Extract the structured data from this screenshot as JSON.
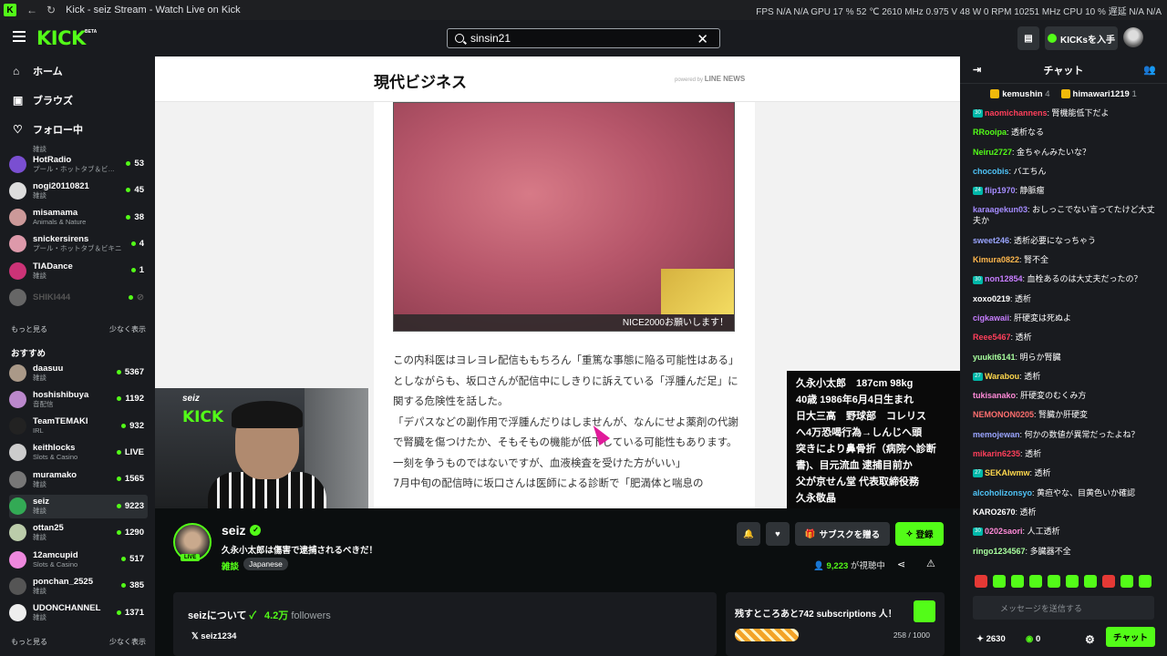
{
  "window": {
    "title": "Kick - seiz Stream - Watch Live on Kick",
    "stats": "FPS N/A N/A   GPU 17 % 52 ℃ 2610 MHz 0.975 V 48 W 0 RPM 10251 MHz   CPU 10 %   遅延 N/A N/A"
  },
  "header": {
    "logo": "KICK",
    "beta": "BETA",
    "search_value": "sinsin21",
    "get_kicks": "KICKsを入手"
  },
  "sidebar": {
    "nav": [
      {
        "label": "ホーム",
        "icon": "home-icon"
      },
      {
        "label": "ブラウズ",
        "icon": "browse-icon"
      },
      {
        "label": "フォロー中",
        "icon": "heart-icon"
      }
    ],
    "partial_category": "雑談",
    "following": [
      {
        "name": "HotRadio",
        "category": "プール・ホットタブ＆ビ…",
        "viewers": "53",
        "color": "#7a4fd1"
      },
      {
        "name": "nogi20110821",
        "category": "雑談",
        "viewers": "45",
        "color": "#ddd"
      },
      {
        "name": "misamama",
        "category": "Animals & Nature",
        "viewers": "38",
        "color": "#c99"
      },
      {
        "name": "snickersirens",
        "category": "プール・ホットタブ＆ビキニ",
        "viewers": "4",
        "color": "#d9a"
      },
      {
        "name": "TIADance",
        "category": "雑談",
        "viewers": "1",
        "color": "#c37"
      },
      {
        "name": "SHIKI444",
        "category": "",
        "viewers": "",
        "color": "#666"
      }
    ],
    "show_more": "もっと見る",
    "show_less": "少なく表示",
    "recommended_title": "おすすめ",
    "recommended": [
      {
        "name": "daasuu",
        "category": "雑談",
        "viewers": "5367",
        "color": "#a98"
      },
      {
        "name": "hoshishibuya",
        "category": "音配信",
        "viewers": "1192",
        "color": "#b8c"
      },
      {
        "name": "TeamTEMAKI",
        "category": "IRL",
        "viewers": "932",
        "color": "#222"
      },
      {
        "name": "keithlocks",
        "category": "Slots & Casino",
        "viewers": "LIVE",
        "color": "#ccc"
      },
      {
        "name": "muramako",
        "category": "雑談",
        "viewers": "1565",
        "color": "#777"
      },
      {
        "name": "seiz",
        "category": "雑談",
        "viewers": "9223",
        "color": "#3a5"
      },
      {
        "name": "ottan25",
        "category": "雑談",
        "viewers": "1290",
        "color": "#bca"
      },
      {
        "name": "12amcupid",
        "category": "Slots & Casino",
        "viewers": "517",
        "color": "#e8d"
      },
      {
        "name": "ponchan_2525",
        "category": "雑談",
        "viewers": "385",
        "color": "#555"
      },
      {
        "name": "UDONCHANNEL",
        "category": "雑談",
        "viewers": "1371",
        "color": "#eee"
      }
    ]
  },
  "article": {
    "site": "現代ビジネス",
    "powered": "powered by",
    "line_news": "LINE NEWS",
    "caption": "NICE2000お願いします！",
    "paragraphs": [
      "この内科医はヨレヨレ配信ももちろん「重篤な事態に陥る可能性はある」としながらも、坂口さんが配信中にしきりに訴えている「浮腫んだ足」に関する危険性を話した。",
      "「デパスなどの副作用で浮腫んだりはしませんが、なんにせよ薬剤の代謝で腎臓を傷つけたか、そもそもの機能が低下している可能性もあります。一刻を争うものではないですが、血液検査を受けた方がいい」",
      "7月中旬の配信時に坂口さんは医師による診断で「肥満体と喘息の"
    ]
  },
  "webcam": {
    "label": "seiz",
    "brand": "KICK"
  },
  "overlay_lines": [
    "久永小太郎　187cm 98kg",
    "40歳 1986年6月4日生まれ",
    "日大三高　野球部　コレリス",
    "へ4万恐喝行為→しんじへ頭",
    "突きにより鼻骨折（病院へ診断",
    "書)、目元流血 逮捕目前か",
    " 父が京せん堂 代表取締役務",
    "久永敬晶"
  ],
  "stream": {
    "name": "seiz",
    "live": "LIVE",
    "title": "久永小太郎は傷害で逮捕されるべきだ！",
    "category": "雑談",
    "tag": "Japanese",
    "subscribe_gift": "サブスクを贈る",
    "follow": "登録",
    "viewers": "9,223",
    "viewers_label": "が視聴中",
    "about_title": "seizについて",
    "followers": "4.2万",
    "followers_label": "followers",
    "x_handle": "seiz1234",
    "goal_text": "残すところあと742 subscriptions 人！",
    "goal_progress": "258 / 1000",
    "goal_fraction": 0.258
  },
  "chat": {
    "title": "チャット",
    "pinned": [
      {
        "user": "kemushin",
        "count": "4"
      },
      {
        "user": "himawari1219",
        "count": "1"
      }
    ],
    "messages": [
      {
        "user": "naomichannens",
        "text": "腎機能低下だよ",
        "color": "#ff3f5b",
        "badge": "30"
      },
      {
        "user": "RRooipa",
        "text": "透析なる",
        "color": "#53fc18",
        "badge": ""
      },
      {
        "user": "Neiru2727",
        "text": "金ちゃんみたいな？",
        "color": "#53fc18",
        "badge": ""
      },
      {
        "user": "chocobis",
        "text": "バエちん",
        "color": "#4fc3f7",
        "badge": ""
      },
      {
        "user": "flip1970",
        "text": "静脈瘤",
        "color": "#a58cff",
        "badge": "24"
      },
      {
        "user": "karaagekun03",
        "text": "おしっこでない言ってたけど大丈夫か",
        "color": "#a58cff",
        "badge": ""
      },
      {
        "user": "sweet246",
        "text": "透析必要になっちゃう",
        "color": "#9aa5ff",
        "badge": ""
      },
      {
        "user": "Kimura0822",
        "text": "腎不全",
        "color": "#ffb84d",
        "badge": ""
      },
      {
        "user": "non12854",
        "text": "血栓あるのは大丈夫だったの？",
        "color": "#c77dff",
        "badge": "30"
      },
      {
        "user": "xoxo0219",
        "text": "透析",
        "color": "#ffffff",
        "badge": ""
      },
      {
        "user": "cigkawaii",
        "text": "肝硬変は死ぬよ",
        "color": "#c77dff",
        "badge": ""
      },
      {
        "user": "Reee5467",
        "text": "透析",
        "color": "#ff3f5b",
        "badge": ""
      },
      {
        "user": "yuukit6141",
        "text": "明らか腎臓",
        "color": "#a8ff9e",
        "badge": ""
      },
      {
        "user": "Warabou",
        "text": "透析",
        "color": "#ffd84d",
        "badge": "27"
      },
      {
        "user": "tukisanako",
        "text": "肝硬変のむくみ方",
        "color": "#ff8ad8",
        "badge": ""
      },
      {
        "user": "NEMONON0205",
        "text": "腎臓か肝硬変",
        "color": "#ff6f6f",
        "badge": ""
      },
      {
        "user": "memojewan",
        "text": "何かの数値が異常だったよね？",
        "color": "#9aa5ff",
        "badge": ""
      },
      {
        "user": "mikarin6235",
        "text": "透析",
        "color": "#ff3f5b",
        "badge": ""
      },
      {
        "user": "SEKAIwmw",
        "text": "透析",
        "color": "#ffd84d",
        "badge": "27"
      },
      {
        "user": "alcoholizonsyo",
        "text": "黄疸やな、目黄色いか確認",
        "color": "#4fc3f7",
        "badge": ""
      },
      {
        "user": "KARO2670",
        "text": "透析",
        "color": "#ffffff",
        "badge": ""
      },
      {
        "user": "0202saori",
        "text": "人工透析",
        "color": "#ff8ad8",
        "badge": "30"
      },
      {
        "user": "ringo1234567",
        "text": "多臓器不全",
        "color": "#a8ff9e",
        "badge": ""
      }
    ],
    "input_placeholder": "メッセージを送信する",
    "points": "2630",
    "kicks": "0",
    "send": "チャット"
  }
}
